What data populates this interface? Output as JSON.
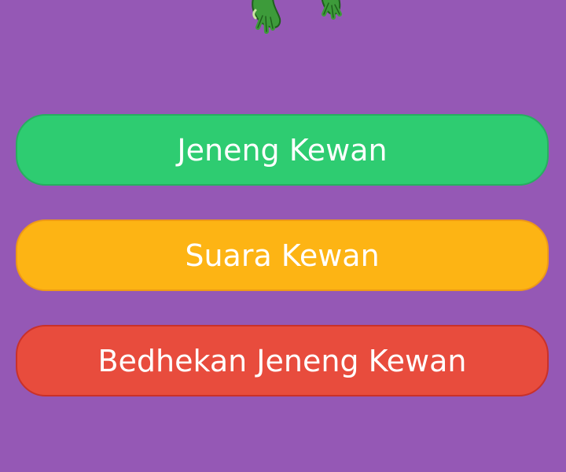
{
  "mascot": {
    "icon": "frog-icon",
    "colors": {
      "body": "#3d9b3a",
      "outline": "#1f5f1d",
      "highlight": "#c9e7a0"
    }
  },
  "menu": {
    "items": [
      {
        "label": "Jeneng Kewan",
        "color": "#2ecc71"
      },
      {
        "label": "Suara Kewan",
        "color": "#fdb414"
      },
      {
        "label": "Bedhekan Jeneng Kewan",
        "color": "#e84c3d"
      }
    ]
  },
  "theme": {
    "background": "#9558b5"
  }
}
